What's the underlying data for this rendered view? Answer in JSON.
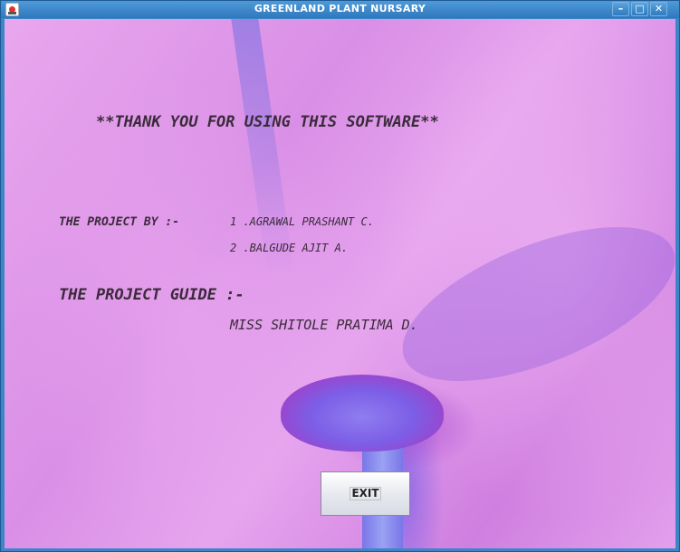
{
  "window": {
    "title": "GREENLAND PLANT NURSARY",
    "minimize_glyph": "–",
    "maximize_glyph": "□",
    "close_glyph": "✕"
  },
  "content": {
    "thanks": "**THANK YOU FOR USING THIS SOFTWARE**",
    "project_by_label": "THE PROJECT BY :-",
    "member1": "1 .AGRAWAL PRASHANT C.",
    "member2": "2 .BALGUDE AJIT A.",
    "guide_label": "THE PROJECT GUIDE :-",
    "guide_name": "MISS SHITOLE PRATIMA D."
  },
  "buttons": {
    "exit_label": "EXIT"
  }
}
